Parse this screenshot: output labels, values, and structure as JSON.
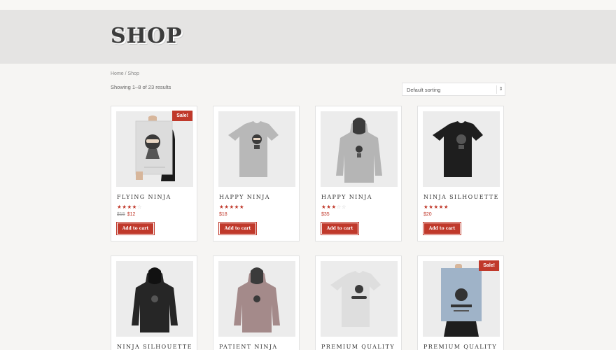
{
  "header": {
    "title": "SHOP"
  },
  "breadcrumb": {
    "home": "Home",
    "separator": " / ",
    "current": "Shop"
  },
  "results": {
    "text": "Showing 1–8 of 23 results"
  },
  "sorting": {
    "selected": "Default sorting"
  },
  "colors": {
    "accent": "#c0392b",
    "header_bg": "#e5e4e3"
  },
  "products": [
    {
      "name": "Flying Ninja",
      "sale_badge": "Sale!",
      "rating": 4,
      "old_price": "$15",
      "price": "$12",
      "button": "Add to cart",
      "image": "poster-flying-ninja"
    },
    {
      "name": "Happy Ninja",
      "rating": 5,
      "price": "$18",
      "button": "Add to cart",
      "image": "tshirt-gray"
    },
    {
      "name": "Happy Ninja",
      "rating": 3,
      "price": "$35",
      "button": "Add to cart",
      "image": "hoodie-gray"
    },
    {
      "name": "Ninja Silhouette",
      "rating": 5,
      "price": "$20",
      "button": "Add to cart",
      "image": "tshirt-black"
    },
    {
      "name": "Ninja Silhouette",
      "image": "hoodie-black"
    },
    {
      "name": "Patient Ninja",
      "image": "hoodie-mauve"
    },
    {
      "name": "Premium Quality",
      "image": "tshirt-white"
    },
    {
      "name": "Premium Quality",
      "sale_badge": "Sale!",
      "image": "poster-premium"
    }
  ]
}
